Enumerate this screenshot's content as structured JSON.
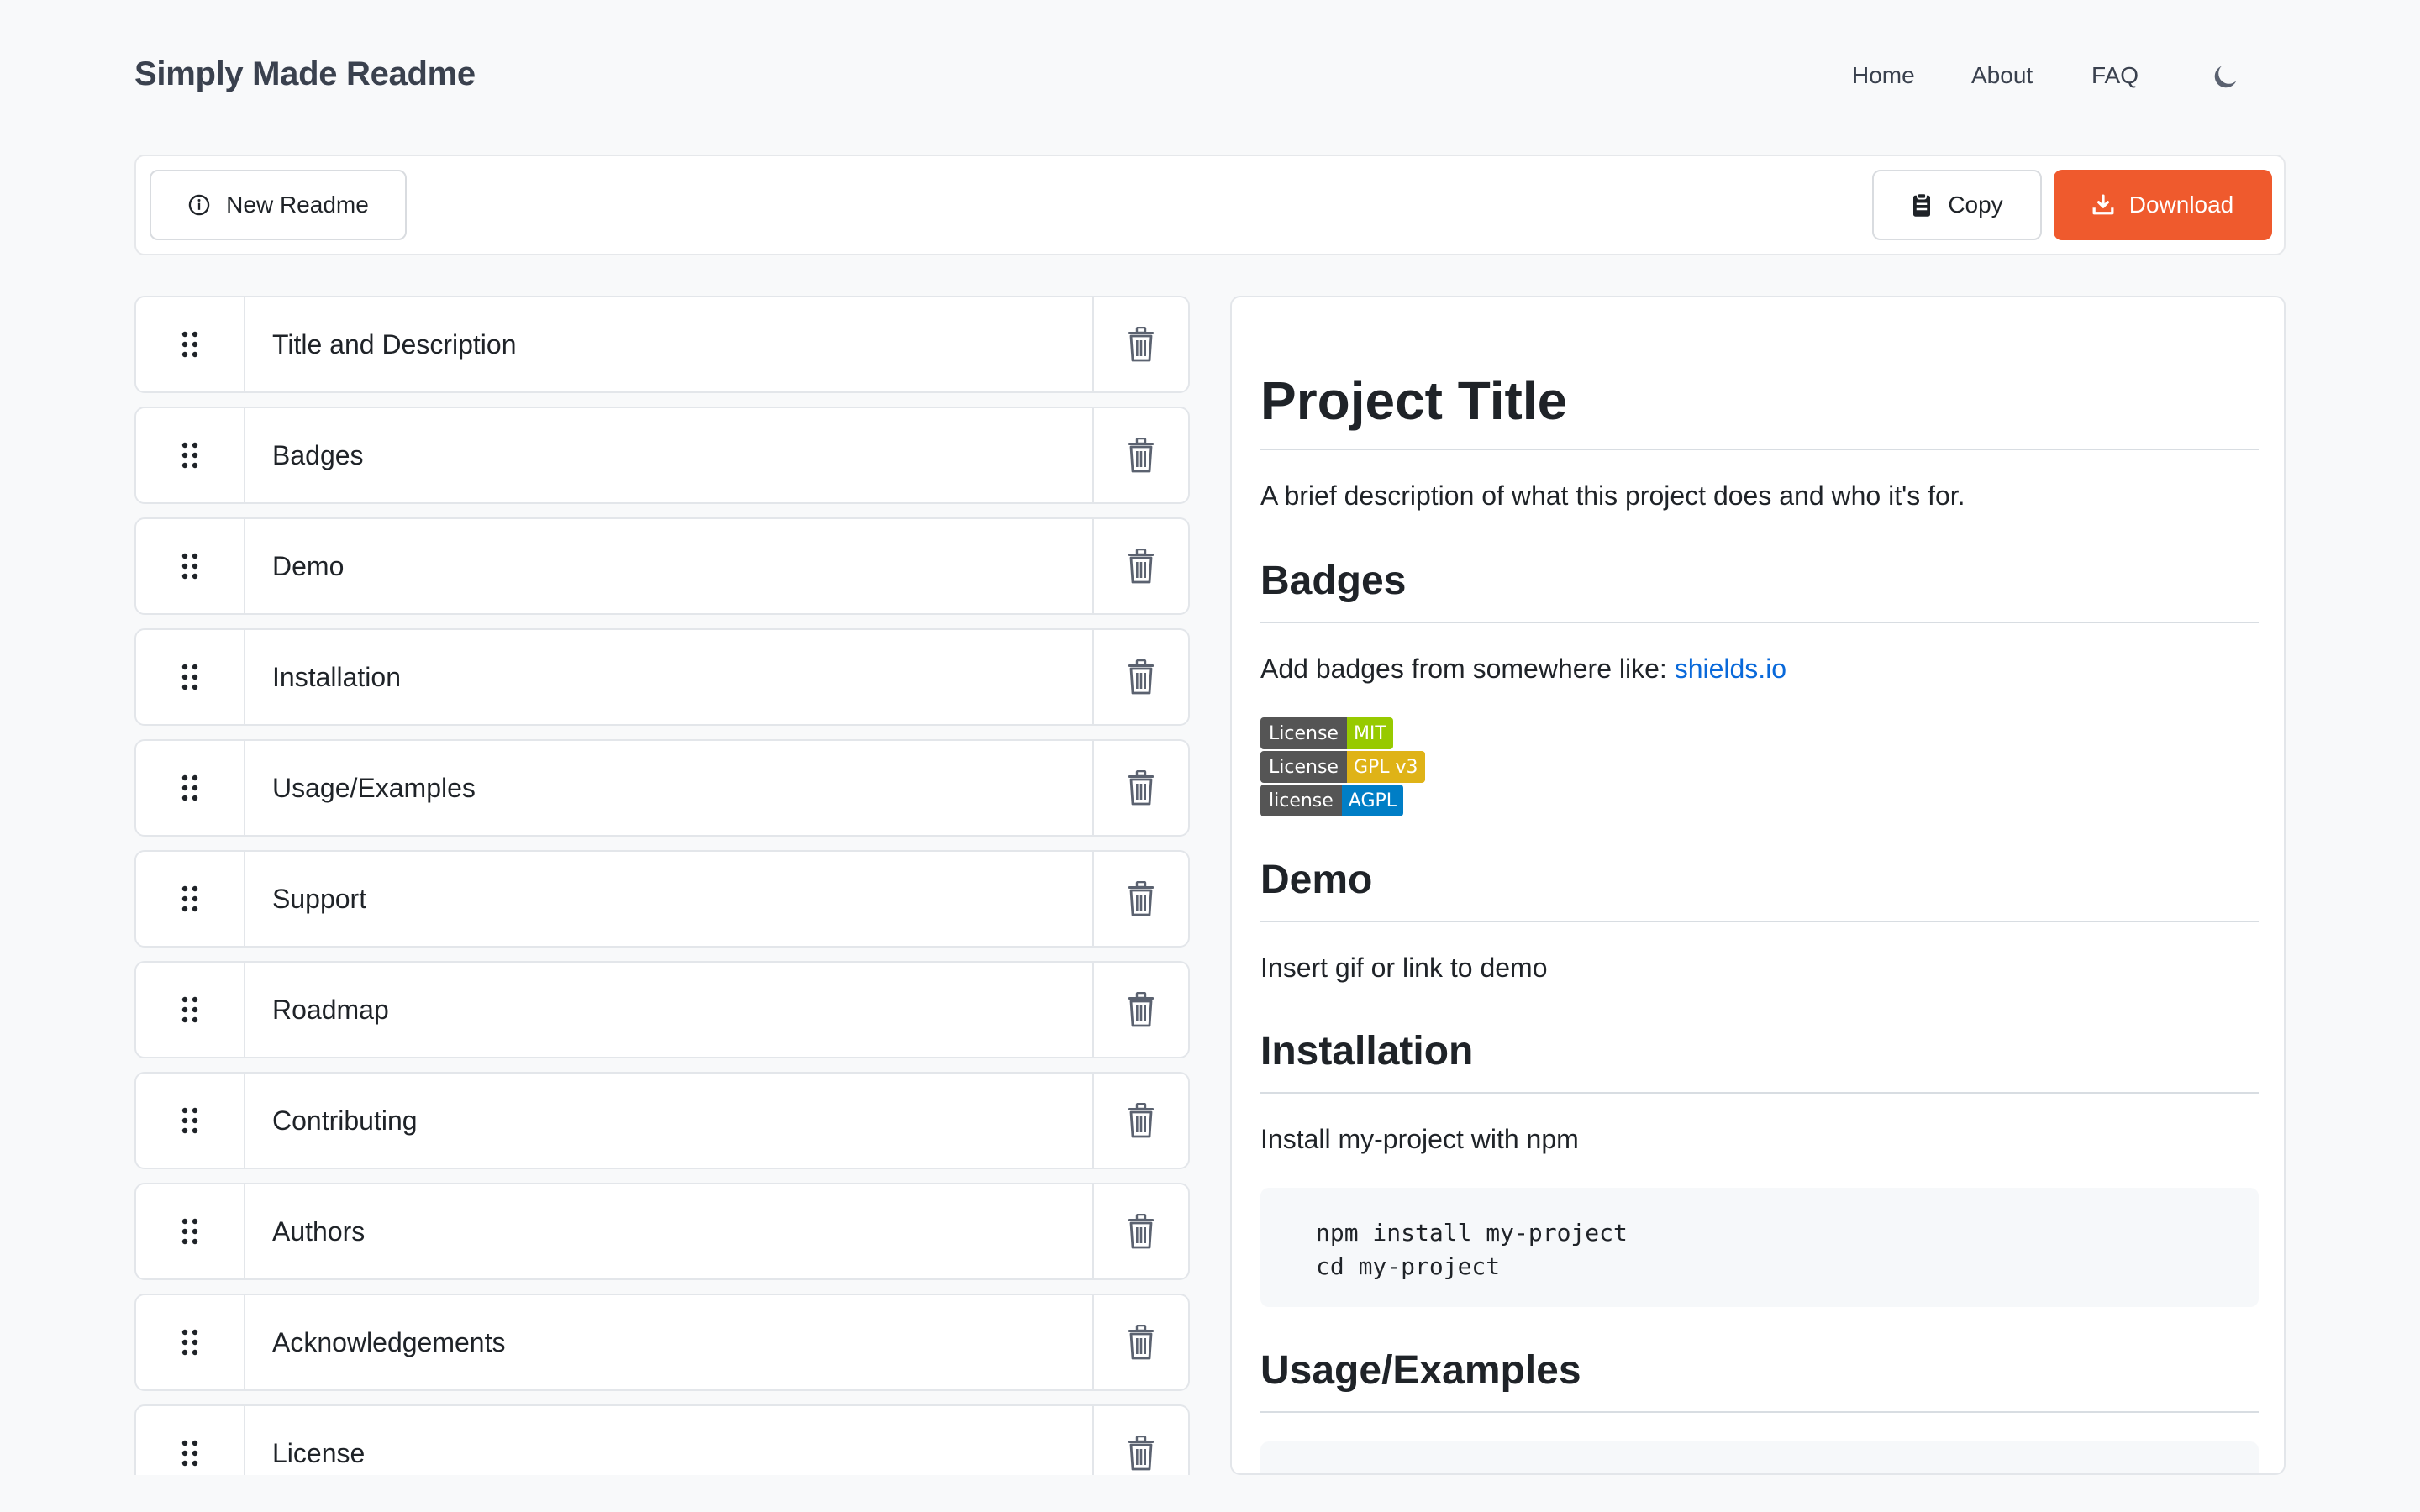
{
  "header": {
    "brand": "Simply Made Readme",
    "nav": [
      "Home",
      "About",
      "FAQ"
    ],
    "theme_toggle_icon": "moon-icon"
  },
  "toolbar": {
    "new_readme_label": "New Readme",
    "copy_label": "Copy",
    "download_label": "Download",
    "download_color": "#ef5a2d"
  },
  "sections": [
    "Title and Description",
    "Badges",
    "Demo",
    "Installation",
    "Usage/Examples",
    "Support",
    "Roadmap",
    "Contributing",
    "Authors",
    "Acknowledgements",
    "License"
  ],
  "preview": {
    "title": "Project Title",
    "description": "A brief description of what this project does and who it's for.",
    "badges_heading": "Badges",
    "badges_text": "Add badges from somewhere like: ",
    "badges_link": "shields.io",
    "badges": [
      {
        "left": "License",
        "right": "MIT",
        "color": "#97ca00"
      },
      {
        "left": "License",
        "right": "GPL v3",
        "color": "#dfb317"
      },
      {
        "left": "license",
        "right": "AGPL",
        "color": "#007ec6"
      }
    ],
    "demo_heading": "Demo",
    "demo_text": "Insert gif or link to demo",
    "installation_heading": "Installation",
    "installation_text": "Install my-project with npm",
    "code_lines": [
      "npm install my-project",
      "cd my-project"
    ],
    "usage_heading": "Usage/Examples"
  }
}
